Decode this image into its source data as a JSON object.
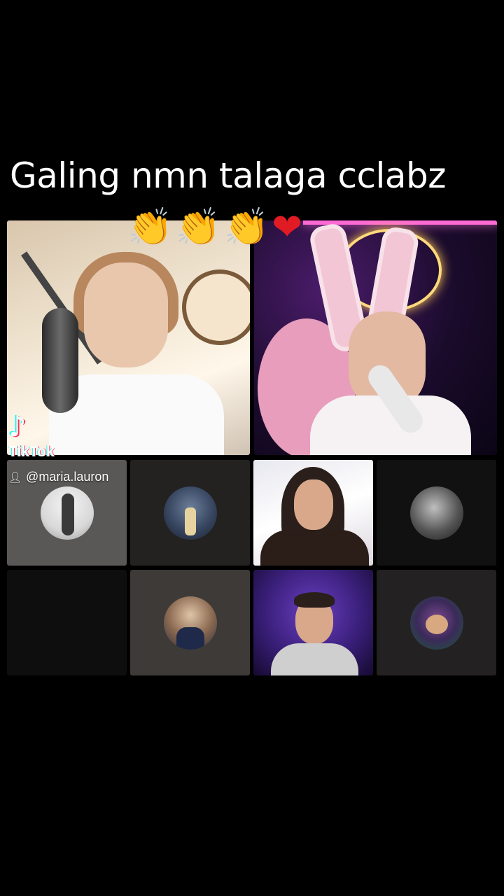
{
  "caption": {
    "text": "Galing nmn talaga cclabz",
    "emojis": [
      "👏",
      "👏",
      "👏",
      "❤"
    ]
  },
  "watermark": {
    "brand": "TikTok",
    "logo_glyph": "♪",
    "handle": "@maria.lauron",
    "user_icon": "person-icon"
  },
  "grid": {
    "main_participants": [
      "host-video-left",
      "host-video-right"
    ],
    "small_tiles": [
      {
        "kind": "avatar",
        "bg": "#5a5857"
      },
      {
        "kind": "avatar",
        "bg": "#232220"
      },
      {
        "kind": "video",
        "bg": "#efeef2"
      },
      {
        "kind": "avatar",
        "bg": "#111111"
      },
      {
        "kind": "empty",
        "bg": "#0e0e0e"
      },
      {
        "kind": "avatar",
        "bg": "#3d3a37"
      },
      {
        "kind": "video",
        "bg": "#3a1f7a"
      },
      {
        "kind": "avatar",
        "bg": "#232121"
      }
    ]
  },
  "colors": {
    "background": "#000000",
    "tiktok_cyan": "#25f4ee",
    "tiktok_red": "#fe2c55"
  }
}
